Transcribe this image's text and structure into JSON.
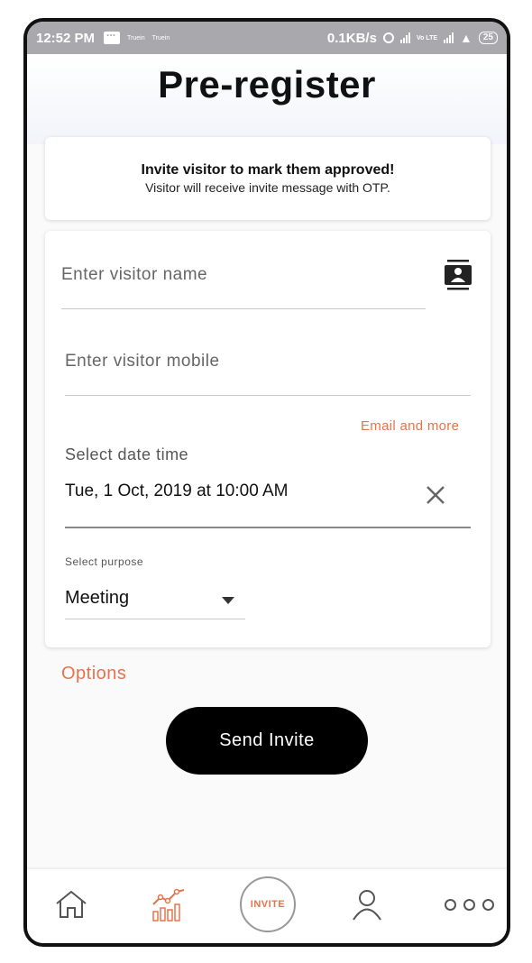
{
  "status_bar": {
    "time": "12:52 PM",
    "notif_1": "Truein",
    "notif_2": "Truein",
    "speed": "0.1KB/s",
    "battery": "25",
    "lte": "Vo LTE"
  },
  "header": {
    "title": "Pre-register"
  },
  "info_card": {
    "headline": "Invite visitor to mark them approved!",
    "subtext": "Visitor will receive invite message with OTP."
  },
  "form": {
    "name_placeholder": "Enter visitor name",
    "mobile_placeholder": "Enter visitor mobile",
    "email_link": "Email and more",
    "datetime_label": "Select date time",
    "datetime_value": "Tue, 1 Oct, 2019 at 10:00 AM",
    "purpose_label": "Select purpose",
    "purpose_value": "Meeting"
  },
  "options_link": "Options",
  "send_button": "Send Invite",
  "bottom_nav": {
    "invite_label": "INVITE",
    "icons": [
      "home-icon",
      "analytics-icon",
      "invite-icon",
      "profile-icon",
      "more-icon"
    ]
  },
  "colors": {
    "accent": "#e8734a",
    "button_bg": "#000000",
    "status_bar": "#a9a9ad"
  }
}
